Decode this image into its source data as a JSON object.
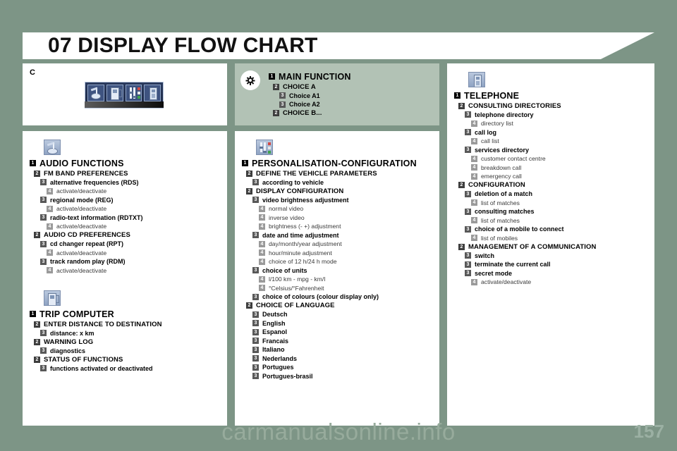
{
  "header": {
    "title": "07 DISPLAY FLOW CHART"
  },
  "page_number": "157",
  "watermark": "carmanualsonline.info",
  "colors": {
    "page_background": "#7d9586",
    "panel_background": "#ffffff",
    "tinted_panel_background": "#b2c2b5",
    "level1_marker": "#000000",
    "level2_marker": "#3d3d3d",
    "level3_marker": "#585858",
    "level4_marker": "#9a9a9a"
  },
  "panels": {
    "screen": {
      "letter": "C",
      "icons": [
        "audio-icon",
        "trip-computer-icon",
        "personalisation-icon",
        "telephone-icon"
      ]
    },
    "main_function": {
      "icon": "brightness-sun-icon",
      "items": [
        {
          "level": 1,
          "label": "MAIN FUNCTION"
        },
        {
          "level": 2,
          "label": "CHOICE A"
        },
        {
          "level": 3,
          "label": "Choice A1"
        },
        {
          "level": 3,
          "label": "Choice A2"
        },
        {
          "level": 2,
          "label": "CHOICE B..."
        }
      ]
    },
    "audio": {
      "icon": "audio-icon",
      "items": [
        {
          "level": 1,
          "label": "AUDIO FUNCTIONS"
        },
        {
          "level": 2,
          "label": "FM BAND PREFERENCES"
        },
        {
          "level": 3,
          "label": "alternative frequencies (RDS)"
        },
        {
          "level": 4,
          "label": "activate/deactivate"
        },
        {
          "level": 3,
          "label": "regional mode (REG)"
        },
        {
          "level": 4,
          "label": "activate/deactivate"
        },
        {
          "level": 3,
          "label": "radio-text information (RDTXT)"
        },
        {
          "level": 4,
          "label": "activate/deactivate"
        },
        {
          "level": 2,
          "label": "AUDIO CD PREFERENCES"
        },
        {
          "level": 3,
          "label": "cd changer repeat (RPT)"
        },
        {
          "level": 4,
          "label": "activate/deactivate"
        },
        {
          "level": 3,
          "label": "track random play (RDM)"
        },
        {
          "level": 4,
          "label": "activate/deactivate"
        }
      ]
    },
    "trip_computer": {
      "icon": "trip-computer-icon",
      "items": [
        {
          "level": 1,
          "label": "TRIP COMPUTER"
        },
        {
          "level": 2,
          "label": "ENTER DISTANCE TO DESTINATION"
        },
        {
          "level": 3,
          "label": "distance: x km"
        },
        {
          "level": 2,
          "label": "WARNING LOG"
        },
        {
          "level": 3,
          "label": "diagnostics"
        },
        {
          "level": 2,
          "label": "STATUS OF FUNCTIONS"
        },
        {
          "level": 3,
          "label": "functions activated or deactivated"
        }
      ]
    },
    "personalisation": {
      "icon": "personalisation-icon",
      "items": [
        {
          "level": 1,
          "label": "PERSONALISATION-CONFIGURATION"
        },
        {
          "level": 2,
          "label": "DEFINE THE VEHICLE PARAMETERS"
        },
        {
          "level": 3,
          "label": "according to vehicle"
        },
        {
          "level": 2,
          "label": "DISPLAY CONFIGURATION"
        },
        {
          "level": 3,
          "label": "video brightness adjustment"
        },
        {
          "level": 4,
          "label": "normal video"
        },
        {
          "level": 4,
          "label": "inverse video"
        },
        {
          "level": 4,
          "label": "brightness (- +) adjustment"
        },
        {
          "level": 3,
          "label": "date and time adjustment"
        },
        {
          "level": 4,
          "label": "day/month/year adjustment"
        },
        {
          "level": 4,
          "label": "hour/minute adjustment"
        },
        {
          "level": 4,
          "label": "choice of 12 h/24 h mode"
        },
        {
          "level": 3,
          "label": "choice of units"
        },
        {
          "level": 4,
          "label": "l/100 km - mpg - km/l"
        },
        {
          "level": 4,
          "label": "°Celsius/°Fahrenheit"
        },
        {
          "level": 3,
          "label": "choice of colours (colour display only)"
        },
        {
          "level": 2,
          "label": "CHOICE OF LANGUAGE"
        },
        {
          "level": 3,
          "label": "Deutsch"
        },
        {
          "level": 3,
          "label": "English"
        },
        {
          "level": 3,
          "label": "Espanol"
        },
        {
          "level": 3,
          "label": "Francais"
        },
        {
          "level": 3,
          "label": "Italiano"
        },
        {
          "level": 3,
          "label": "Nederlands"
        },
        {
          "level": 3,
          "label": "Portugues"
        },
        {
          "level": 3,
          "label": "Portugues-brasil"
        }
      ]
    },
    "telephone": {
      "icon": "telephone-icon",
      "items": [
        {
          "level": 1,
          "label": "TELEPHONE"
        },
        {
          "level": 2,
          "label": "CONSULTING DIRECTORIES"
        },
        {
          "level": 3,
          "label": "telephone directory"
        },
        {
          "level": 4,
          "label": "directory list"
        },
        {
          "level": 3,
          "label": "call log"
        },
        {
          "level": 4,
          "label": "call list"
        },
        {
          "level": 3,
          "label": "services directory"
        },
        {
          "level": 4,
          "label": "customer contact centre"
        },
        {
          "level": 4,
          "label": "breakdown call"
        },
        {
          "level": 4,
          "label": "emergency call"
        },
        {
          "level": 2,
          "label": "CONFIGURATION"
        },
        {
          "level": 3,
          "label": "deletion of a match"
        },
        {
          "level": 4,
          "label": "list of matches"
        },
        {
          "level": 3,
          "label": "consulting matches"
        },
        {
          "level": 4,
          "label": "list of matches"
        },
        {
          "level": 3,
          "label": "choice of a mobile to connect"
        },
        {
          "level": 4,
          "label": "list of mobiles"
        },
        {
          "level": 2,
          "label": "MANAGEMENT OF A COMMUNICATION"
        },
        {
          "level": 3,
          "label": "switch"
        },
        {
          "level": 3,
          "label": "terminate the current call"
        },
        {
          "level": 3,
          "label": "secret mode"
        },
        {
          "level": 4,
          "label": "activate/deactivate"
        }
      ]
    }
  }
}
